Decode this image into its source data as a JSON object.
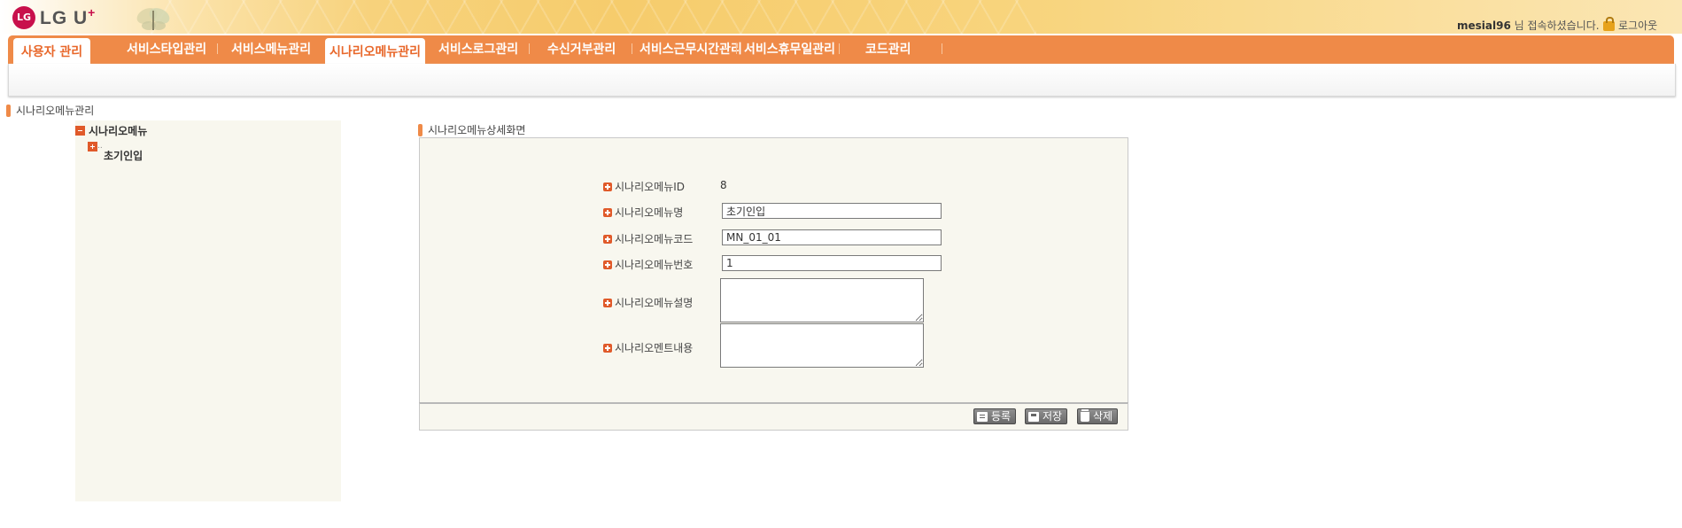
{
  "header": {
    "logo_text": "LG U",
    "logo_sup": "+",
    "logo_mark": "LG",
    "user_id": "mesial96",
    "user_suffix": " 님 접속하셨습니다.",
    "logout_label": "로그아웃",
    "logout_icon": "lock-icon"
  },
  "nav": {
    "items": [
      {
        "label": "사용자 관리"
      },
      {
        "label": "서비스타입관리"
      },
      {
        "label": "서비스메뉴관리"
      },
      {
        "label": "시나리오메뉴관리"
      },
      {
        "label": "서비스로그관리"
      },
      {
        "label": "수신거부관리"
      },
      {
        "label": "서비스근무시간관리"
      },
      {
        "label": "서비스휴무일관리"
      },
      {
        "label": "코드관리"
      }
    ],
    "active_index": 3
  },
  "page": {
    "title": "시나리오메뉴관리"
  },
  "tree": {
    "root_label": "시나리오메뉴",
    "child_prefix": "..",
    "child_label": "초기인입"
  },
  "detail": {
    "title": "시나리오메뉴상세화면",
    "fields": {
      "id_label": "시나리오메뉴ID",
      "id_value": "8",
      "name_label": "시나리오메뉴명",
      "name_value": "초기인입",
      "code_label": "시나리오메뉴코드",
      "code_value": "MN_01_01",
      "number_label": "시나리오메뉴번호",
      "number_value": "1",
      "desc_label": "시나리오메뉴설명",
      "desc_value": "",
      "ment_label": "시나리오멘트내용",
      "ment_value": ""
    },
    "buttons": {
      "register": "등록",
      "save": "저장",
      "delete": "삭제"
    }
  },
  "colors": {
    "nav_orange": "#ef8a48",
    "active_tab_text": "#e8672a",
    "panel_bg": "#f8f7ef"
  }
}
